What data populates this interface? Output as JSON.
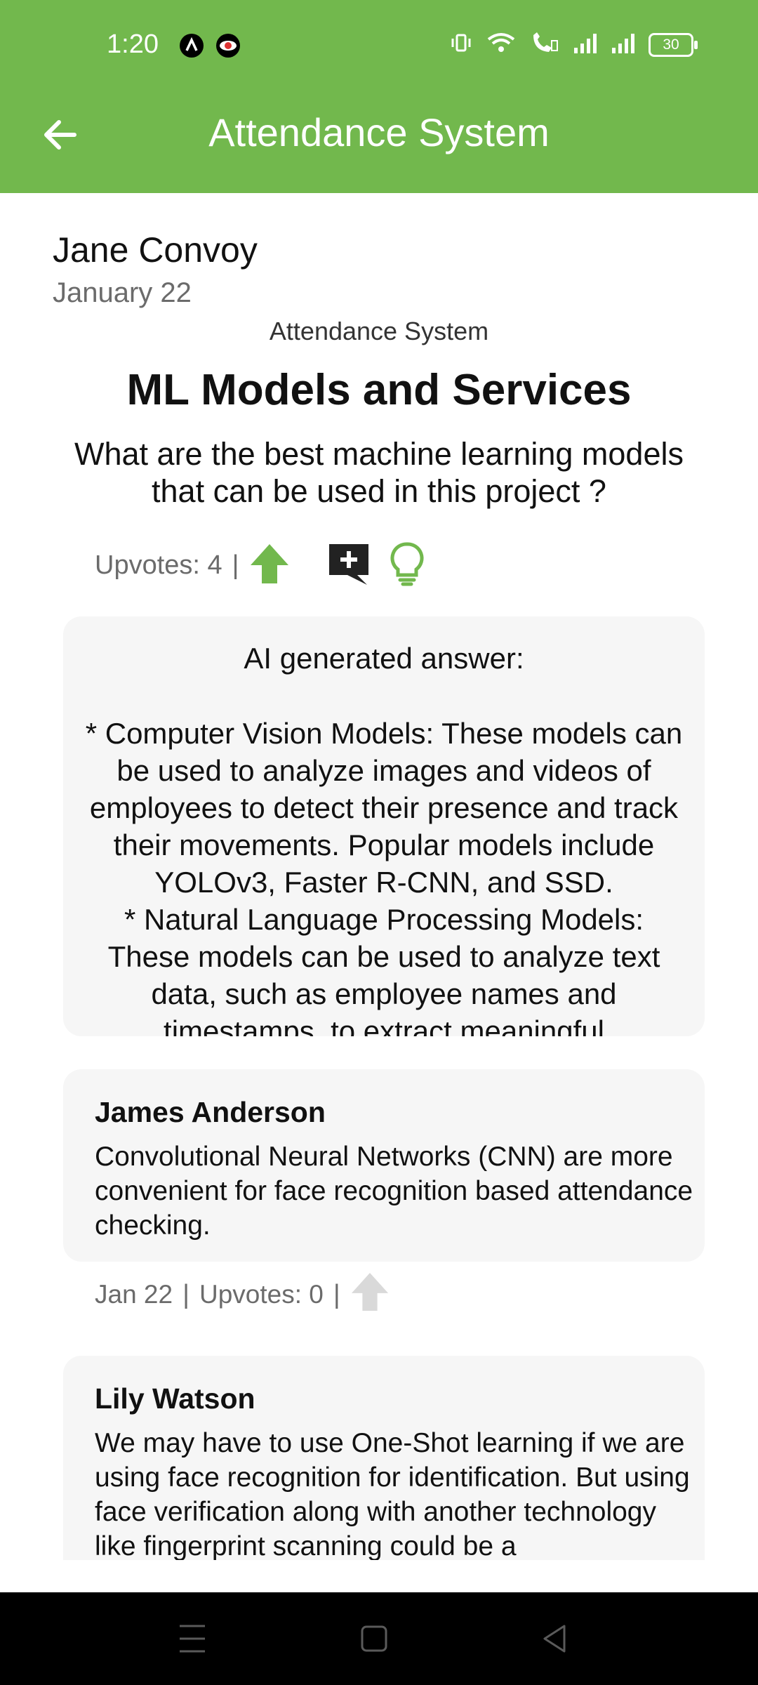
{
  "status_bar": {
    "time": "1:20",
    "battery": "30",
    "icons": [
      "app-icon-a",
      "eye-icon",
      "vibrate-icon",
      "wifi-icon",
      "wifi-call-icon",
      "signal-icon",
      "signal-icon"
    ]
  },
  "header": {
    "title": "Attendance System",
    "back_icon": "arrow-left-icon",
    "background_color": "#72b84d"
  },
  "post": {
    "author": "Jane Convoy",
    "date": "January 22",
    "category": "Attendance System",
    "title": "ML Models and Services",
    "question": "What are the best machine learning models that can be used in this project ?",
    "upvotes_label": "Upvotes: 4",
    "separator": "|",
    "upvote_icon": "arrow-up-icon",
    "comment_icon": "add-comment-icon",
    "idea_icon": "lightbulb-icon",
    "accent_color": "#72b84d"
  },
  "ai_answer": {
    "heading": "AI generated answer:",
    "body": "* Computer Vision Models: These models can be used to analyze images and videos of employees to detect their presence and track their movements. Popular models include YOLOv3, Faster R-CNN, and SSD.\n* Natural Language Processing Models: These models can be used to analyze text data, such as employee names and timestamps, to extract meaningful"
  },
  "answers": [
    {
      "name": "James Anderson",
      "text": "Convolutional Neural Networks (CNN) are more convenient for face recognition based attendance checking.",
      "date": "Jan 22",
      "upvotes_label": "Upvotes: 0"
    },
    {
      "name": "Lily Watson",
      "text": "We may have to use One-Shot learning if we are using face recognition for identification. But using face verification along with another technology like fingerprint scanning could be a"
    }
  ],
  "nav_bar": {
    "icons": [
      "menu-icon",
      "home-square-icon",
      "back-triangle-icon"
    ]
  }
}
